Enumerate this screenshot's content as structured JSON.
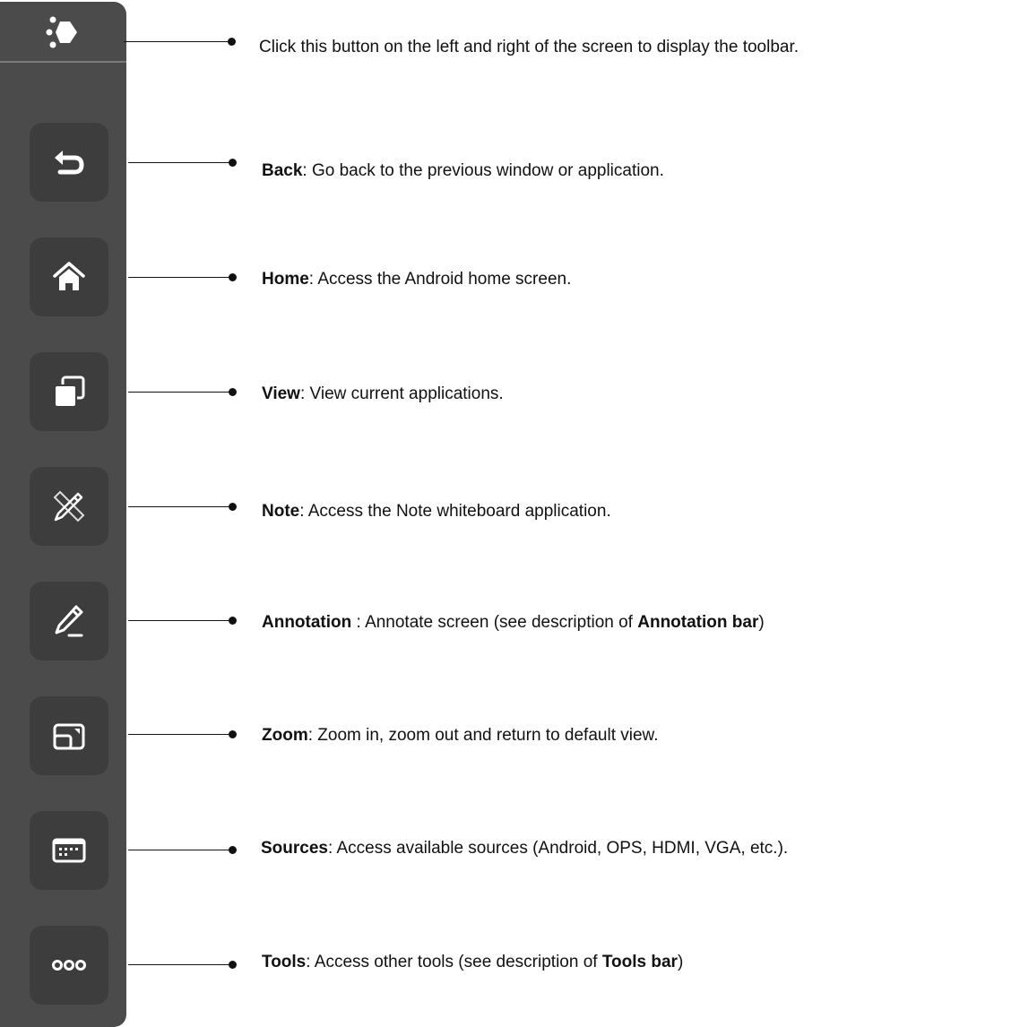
{
  "intro": "Click this button on the left and right of the screen to display the toolbar.",
  "items": [
    {
      "label": "Back",
      "sep": ": ",
      "text": "Go back to the previous window or application.",
      "icon": "back-icon"
    },
    {
      "label": "Home",
      "sep": ": ",
      "text": "Access the Android home screen.",
      "icon": "home-icon"
    },
    {
      "label": "View",
      "sep": ": ",
      "text": "View current applications.",
      "icon": "windows-icon"
    },
    {
      "label": "Note",
      "sep": ": ",
      "text": "Access the Note whiteboard application.",
      "icon": "pencil-ruler-icon"
    },
    {
      "label": "Annotation",
      "sep": " : ",
      "text": "Annotate screen (see description of ",
      "ref": "Annotation bar",
      "tail": ")",
      "icon": "pen-icon"
    },
    {
      "label": "Zoom",
      "sep": ": ",
      "text": "Zoom in, zoom out and return to default view.",
      "icon": "zoom-icon"
    },
    {
      "label": "Sources",
      "sep": ": ",
      "text": "Access available sources (Android, OPS, HDMI, VGA, etc.).",
      "icon": "sources-icon"
    },
    {
      "label": "Tools",
      "sep": ": ",
      "text": "Access other tools (see description of ",
      "ref": "Tools bar",
      "tail": ")",
      "icon": "more-icon"
    }
  ],
  "colors": {
    "toolbar": "#4b4b4b",
    "button": "#3d3d3d",
    "icon": "#ffffff",
    "divider": "#7a7a7a"
  }
}
